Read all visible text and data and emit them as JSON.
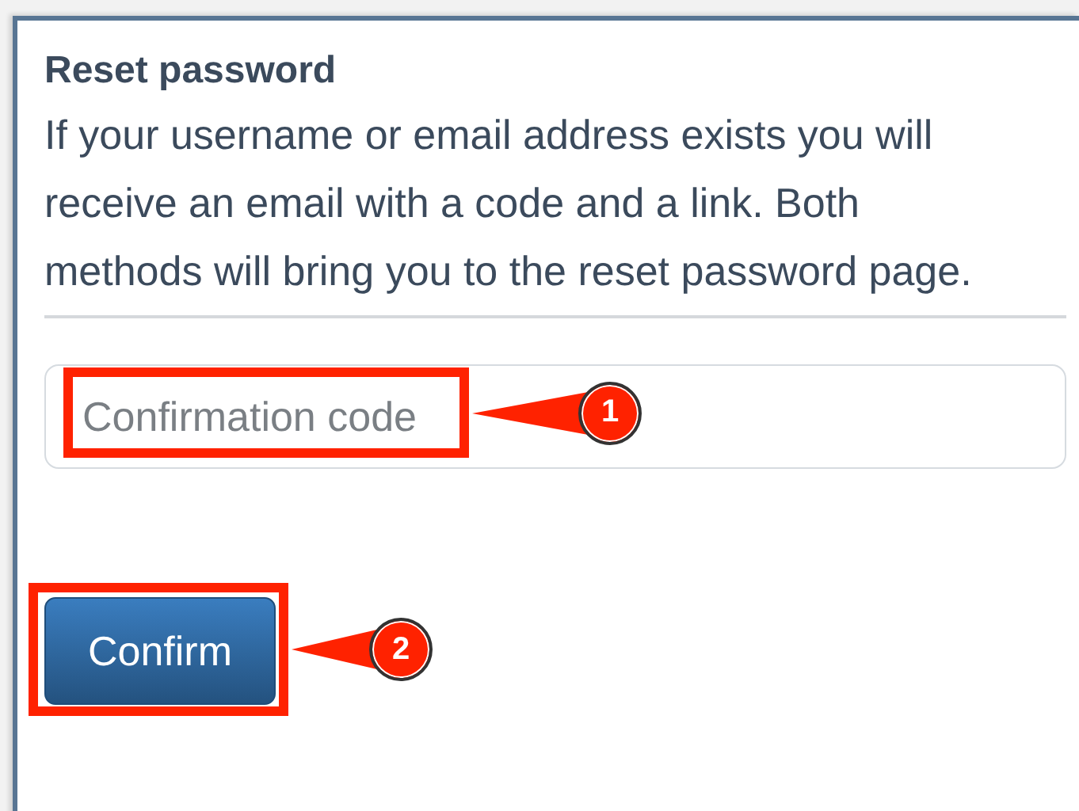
{
  "form": {
    "title": "Reset password",
    "message": "If your username or email address exists you will receive an email with a code and a link. Both methods will bring you to the reset password page.",
    "code_field": {
      "placeholder": "Confirmation code",
      "annotation": "1"
    },
    "confirm_button": {
      "label": "Confirm",
      "annotation": "2"
    }
  }
}
